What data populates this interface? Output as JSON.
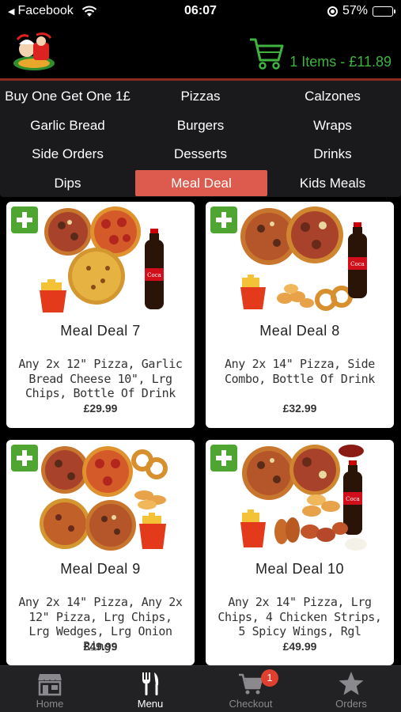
{
  "status_bar": {
    "back_app": "Facebook",
    "time": "06:07",
    "battery": "57%",
    "battery_level": 0.57
  },
  "header": {
    "cart_text": "1 Items - £11.89"
  },
  "categories": [
    {
      "label": "Buy One Get One 1£"
    },
    {
      "label": "Pizzas"
    },
    {
      "label": "Calzones"
    },
    {
      "label": "Garlic Bread"
    },
    {
      "label": "Burgers"
    },
    {
      "label": "Wraps"
    },
    {
      "label": "Side Orders"
    },
    {
      "label": "Desserts"
    },
    {
      "label": "Drinks"
    },
    {
      "label": "Dips"
    },
    {
      "label": "Meal Deal",
      "active": true
    },
    {
      "label": "Kids Meals"
    }
  ],
  "products": [
    {
      "name": "Meal Deal 7",
      "description": "Any 2x 12\" Pizza, Garlic Bread Cheese 10\", Lrg Chips, Bottle Of Drink",
      "price": "£29.99"
    },
    {
      "name": "Meal Deal 8",
      "description": "Any 2x 14\" Pizza, Side Combo, Bottle Of Drink",
      "price": "£32.99"
    },
    {
      "name": "Meal Deal 9",
      "description": "Any 2x 14\" Pizza, Any 2x 12\" Pizza, Lrg Chips, Lrg Wedges, Lrg Onion Rings",
      "price": "£49.99"
    },
    {
      "name": "Meal Deal 10",
      "description": "Any 2x 14\" Pizza, Lrg Chips, 4 Chicken Strips, 5 Spicy Wings, Rgl",
      "price": "£49.99"
    }
  ],
  "tabbar": {
    "tabs": [
      {
        "label": "Home",
        "icon": "store-icon"
      },
      {
        "label": "Menu",
        "icon": "cutlery-icon",
        "active": true
      },
      {
        "label": "Checkout",
        "icon": "cart-icon",
        "badge": "1"
      },
      {
        "label": "Orders",
        "icon": "star-icon"
      }
    ]
  },
  "colors": {
    "accent_green": "#3fb33f",
    "active_category": "#dd5a4f",
    "add_button": "#4ea531",
    "badge": "#e0402f"
  }
}
